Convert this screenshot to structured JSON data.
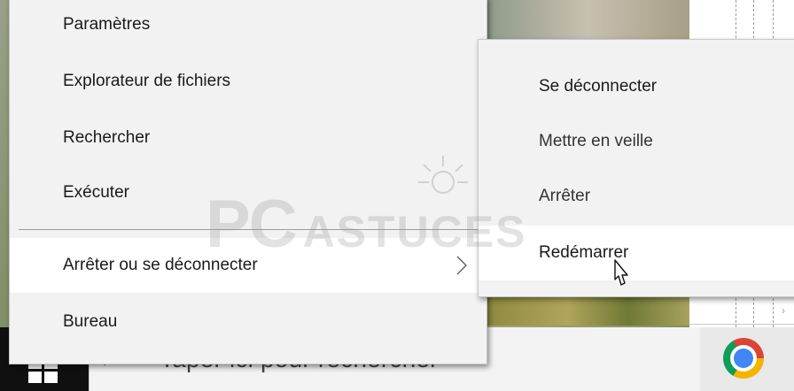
{
  "menu": {
    "items": [
      {
        "label": "Paramètres"
      },
      {
        "label": "Explorateur de fichiers"
      },
      {
        "label": "Rechercher"
      },
      {
        "label": "Exécuter"
      },
      {
        "label": "Arrêter ou se déconnecter",
        "has_submenu": true,
        "state": "hover"
      },
      {
        "label": "Bureau"
      }
    ]
  },
  "submenu": {
    "items": [
      {
        "label": "Se déconnecter"
      },
      {
        "label": "Mettre en veille"
      },
      {
        "label": "Arrêter"
      },
      {
        "label": "Redémarrer",
        "state": "hover"
      }
    ]
  },
  "taskbar": {
    "search_placeholder": "Taper ici pour rechercher",
    "pinned_app_icon": "chrome-icon",
    "start_icon": "windows-logo-icon"
  },
  "watermark": {
    "text_pc": "PC",
    "text_astuces": "ASTUCES"
  },
  "colors": {
    "menu_background": "#f2f2f2",
    "hover_background": "#ffffff",
    "taskbar": "#101010",
    "text": "#1a1a1a"
  }
}
